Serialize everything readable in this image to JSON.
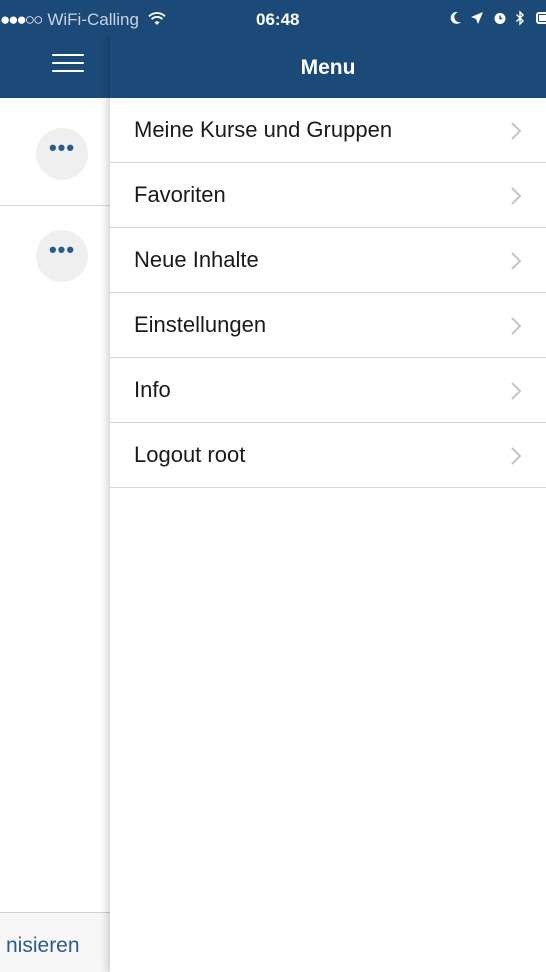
{
  "status_bar": {
    "carrier": "WiFi-Calling",
    "signal_dots": "●●●○○",
    "time": "06:48",
    "icons": [
      "moon-icon",
      "location-arrow-icon",
      "alarm-icon",
      "bluetooth-icon",
      "battery-icon"
    ]
  },
  "background_screen": {
    "footer_label": "nisieren",
    "more_button_label": "•••"
  },
  "menu": {
    "title": "Menu",
    "items": [
      {
        "label": "Meine Kurse und Gruppen"
      },
      {
        "label": "Favoriten"
      },
      {
        "label": "Neue Inhalte"
      },
      {
        "label": "Einstellungen"
      },
      {
        "label": "Info"
      },
      {
        "label": "Logout root"
      }
    ]
  },
  "colors": {
    "header": "#1c4a78",
    "accent": "#2c5c8c",
    "divider": "#d6d6d6"
  }
}
